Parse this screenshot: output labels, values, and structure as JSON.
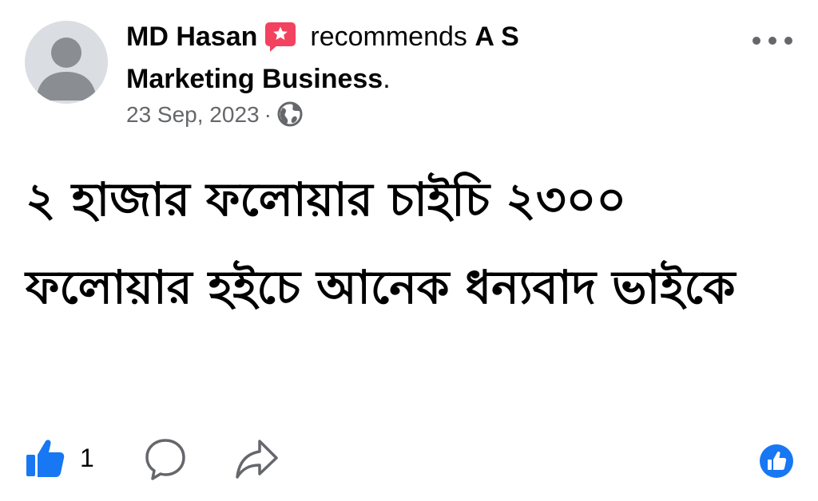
{
  "post": {
    "author": "MD Hasan",
    "action": "recommends",
    "page_name_line1": "A S",
    "page_name_line2": "Marketing Business",
    "period": ".",
    "date": "23 Sep, 2023",
    "separator": "·",
    "privacy_icon": "globe-icon",
    "recommend_icon": "recommend-star-icon",
    "more_icon": "more-dots-icon",
    "body_text": "২ হাজার ফলোয়ার চাইচি ২৩০০ ফলোয়ার হইচে আনেক ধন্যবাদ ভাইকে"
  },
  "actions": {
    "like_count": "1",
    "like_icon": "thumbs-up-icon",
    "comment_icon": "comment-bubble-icon",
    "share_icon": "share-arrow-icon",
    "reaction_icon": "like-reaction-icon"
  },
  "colors": {
    "brand_blue": "#1877f2",
    "recommend_red": "#f3425f",
    "secondary_text": "#65676b",
    "avatar_bg": "#dadde1",
    "avatar_silhouette": "#8a8d91"
  }
}
